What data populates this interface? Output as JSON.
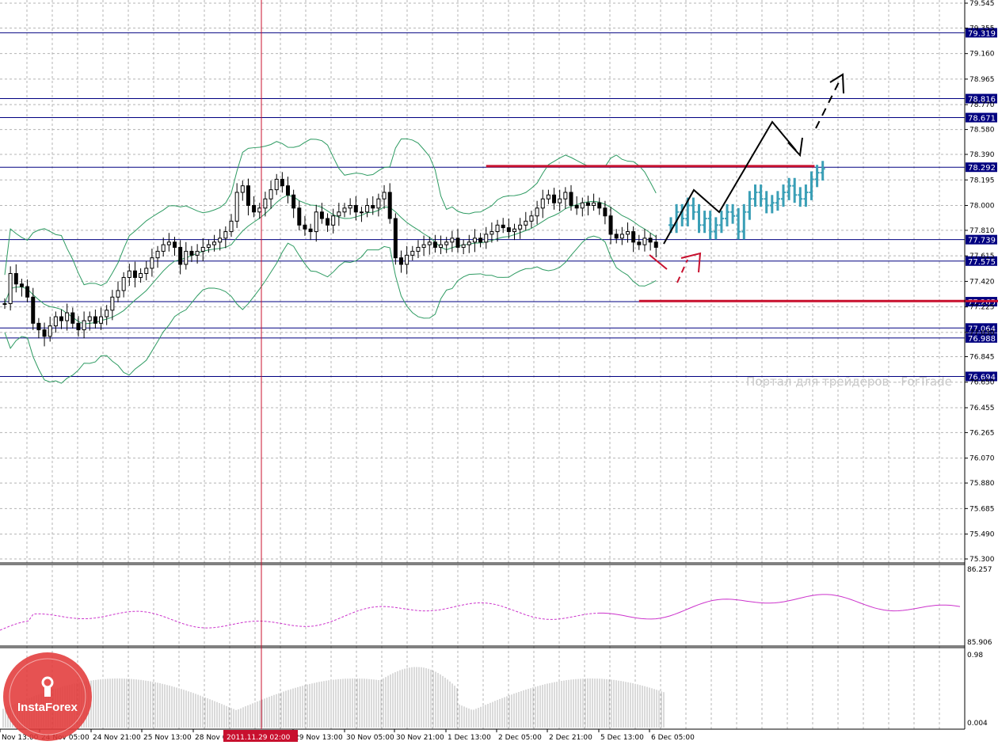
{
  "watermark": "Портал для трейдеров - ForTrade",
  "logo_text": "InstaForex",
  "time_marker_label": "2011.11.29 02:00",
  "colors": {
    "grid": "#b4b4b4",
    "level": "#000080",
    "level_tag": "#000080",
    "candle": "#000000",
    "bands": "#2e9b62",
    "red": "#c8102e",
    "forecast": "#3a9fb6",
    "indicator1": "#cc33cc",
    "histogram": "#b4b4b4",
    "logo": "#e23a3a"
  },
  "chart_data": {
    "type": "candlestick",
    "symbol_note": "",
    "price_axis_ticks": [
      "79.545",
      "79.355",
      "79.160",
      "78.965",
      "78.770",
      "78.580",
      "78.390",
      "78.195",
      "78.000",
      "77.810",
      "77.615",
      "77.420",
      "77.225",
      "77.030",
      "76.845",
      "76.650",
      "76.455",
      "76.265",
      "76.070",
      "75.880",
      "75.685",
      "75.490",
      "75.300"
    ],
    "ylim": [
      75.3,
      79.545
    ],
    "time_axis_labels": [
      "Nov 13:00",
      "24 Nov 05:00",
      "24 Nov 21:00",
      "25 Nov 13:00",
      "28 Nov 05:00",
      "29 Nov 13:00",
      "30 Nov 05:00",
      "30 Nov 21:00",
      "1 Dec 13:00",
      "2 Dec 05:00",
      "2 Dec 21:00",
      "5 Dec 13:00",
      "6 Dec 05:00"
    ],
    "horizontal_levels": [
      "79.319",
      "78.816",
      "78.671",
      "78.292",
      "77.739",
      "77.575",
      "77.265",
      "77.064",
      "76.988",
      "76.694"
    ],
    "support_resistance": [
      {
        "price": 78.3,
        "from_bar": 85,
        "to_bar": 143
      },
      {
        "price": 77.27,
        "from_bar": 112,
        "to_bar": 186
      }
    ],
    "close_path": [
      77.25,
      77.48,
      77.4,
      77.38,
      77.3,
      77.1,
      77.05,
      77.0,
      77.08,
      77.15,
      77.12,
      77.18,
      77.1,
      77.05,
      77.12,
      77.15,
      77.1,
      77.15,
      77.2,
      77.3,
      77.35,
      77.45,
      77.5,
      77.45,
      77.48,
      77.52,
      77.6,
      77.65,
      77.7,
      77.72,
      77.68,
      77.55,
      77.65,
      77.62,
      77.65,
      77.68,
      77.7,
      77.72,
      77.75,
      77.8,
      77.88,
      78.1,
      78.15,
      78.0,
      77.95,
      77.98,
      78.05,
      78.12,
      78.2,
      78.15,
      78.08,
      77.98,
      77.85,
      77.82,
      77.8,
      77.95,
      77.9,
      77.85,
      77.92,
      77.95,
      77.98,
      78.0,
      77.95,
      77.95,
      78.0,
      77.98,
      78.05,
      78.1,
      77.9,
      77.6,
      77.55,
      77.62,
      77.65,
      77.68,
      77.7,
      77.72,
      77.68,
      77.7,
      77.72,
      77.75,
      77.68,
      77.7,
      77.72,
      77.75,
      77.72,
      77.78,
      77.8,
      77.85,
      77.83,
      77.8,
      77.82,
      77.85,
      77.88,
      77.92,
      77.98,
      78.05,
      78.08,
      78.02,
      78.05,
      78.1,
      78.0,
      77.98,
      78.02,
      78.0,
      78.02,
      77.98,
      77.92,
      77.78,
      77.75,
      77.78,
      77.8,
      77.72,
      77.7,
      77.75,
      77.72,
      77.68
    ],
    "forecast_path": [
      77.85,
      77.95,
      77.9,
      78.0,
      77.95,
      77.85,
      77.9,
      77.8,
      77.85,
      77.9,
      77.95,
      77.92,
      77.8,
      77.95,
      78.05,
      78.1,
      78.05,
      78.0,
      78.02,
      78.05,
      78.1,
      78.15,
      78.08,
      78.05,
      78.1,
      78.2,
      78.25,
      78.28
    ],
    "indicator1": {
      "top_label": "86.257",
      "bottom_label": "85.906"
    },
    "indicator2": {
      "top_label": "0.98",
      "bottom_label": "0.004"
    }
  }
}
